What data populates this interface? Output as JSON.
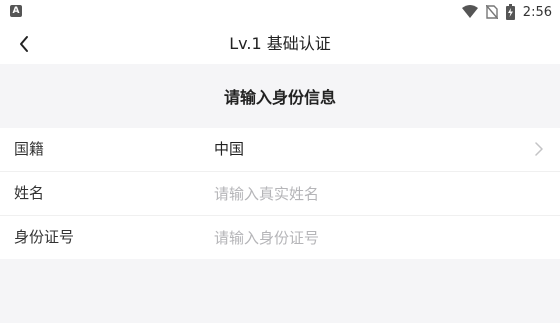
{
  "status_bar": {
    "app_badge": "A",
    "time": "2:56"
  },
  "header": {
    "title": "Lv.1 基础认证"
  },
  "section": {
    "title": "请输入身份信息"
  },
  "form": {
    "nationality": {
      "label": "国籍",
      "value": "中国"
    },
    "name": {
      "label": "姓名",
      "placeholder": "请输入真实姓名",
      "value": ""
    },
    "id_number": {
      "label": "身份证号",
      "placeholder": "请输入身份证号",
      "value": ""
    }
  }
}
